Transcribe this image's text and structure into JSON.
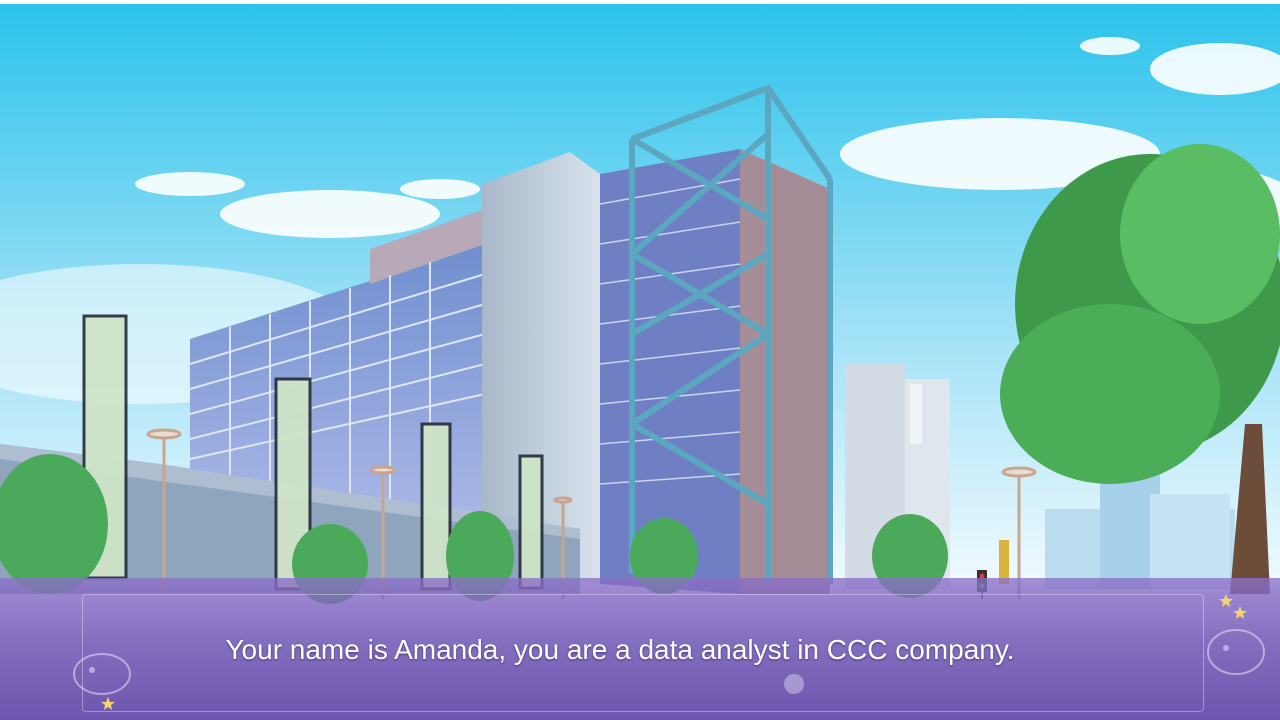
{
  "dialogue": {
    "text": "Your name is Amanda, you are a data analyst in CCC company."
  },
  "scene": {
    "background": "office-building-exterior",
    "colors": {
      "sky_top": "#2fc7ee",
      "sky_bottom": "#eaf7fd",
      "dialogue_box": "#7a5cbf",
      "text": "#ffffff"
    }
  },
  "decorations": {
    "icons": [
      "star-icon",
      "fish-doodle-icon",
      "flower-icon"
    ]
  }
}
